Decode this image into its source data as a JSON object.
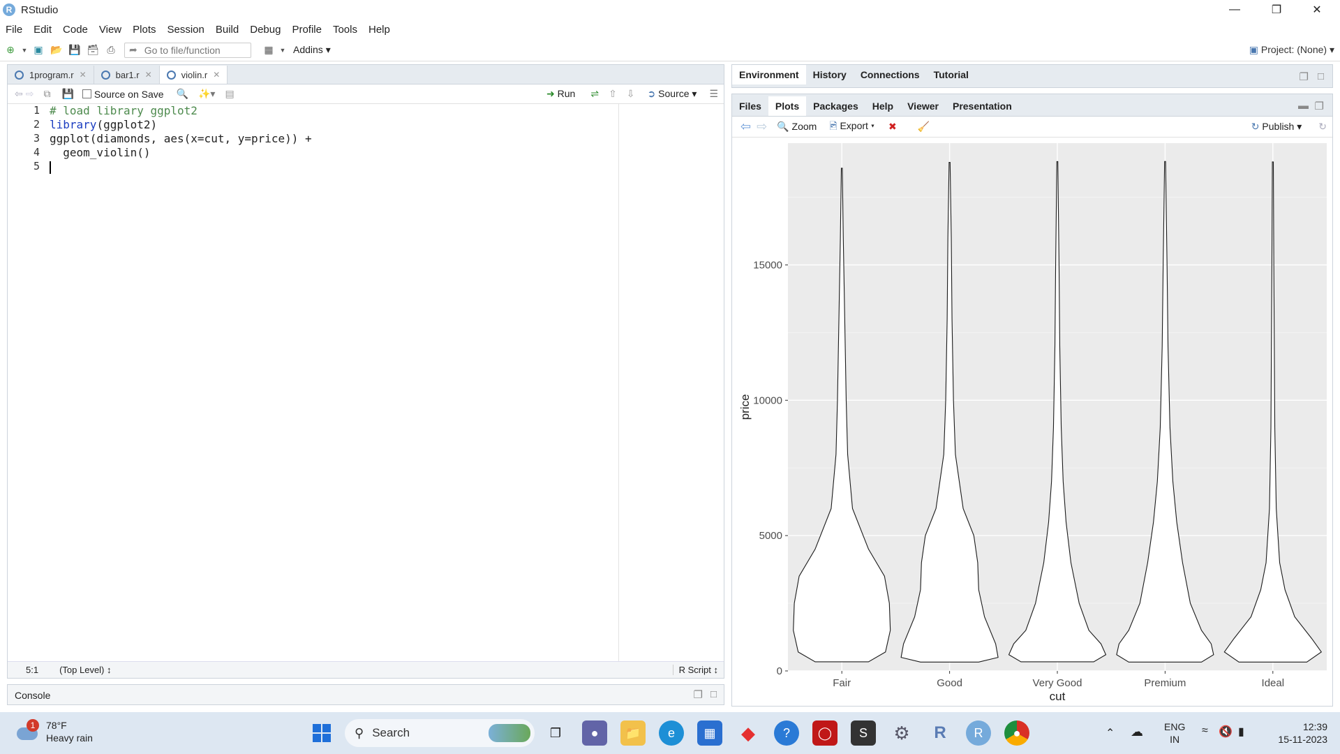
{
  "app": {
    "title": "RStudio",
    "logo_letter": "R"
  },
  "menu": [
    "File",
    "Edit",
    "Code",
    "View",
    "Plots",
    "Session",
    "Build",
    "Debug",
    "Profile",
    "Tools",
    "Help"
  ],
  "toolbar": {
    "goto_placeholder": "Go to file/function",
    "addins": "Addins",
    "project": "Project: (None)"
  },
  "editor": {
    "tabs": [
      {
        "label": "1program.r"
      },
      {
        "label": "bar1.r"
      },
      {
        "label": "violin.r"
      }
    ],
    "source_on_save": "Source on Save",
    "run_label": "Run",
    "source_label": "Source",
    "line_numbers": [
      "1",
      "2",
      "3",
      "4",
      "5"
    ],
    "lines": [
      {
        "parts": [
          {
            "t": "# load library ggplot2",
            "c": "cmt"
          }
        ]
      },
      {
        "parts": [
          {
            "t": "library",
            "c": "fn"
          },
          {
            "t": "(ggplot2)",
            "c": ""
          }
        ]
      },
      {
        "parts": [
          {
            "t": "ggplot(diamonds, aes(x=cut, y=price)) +",
            "c": ""
          }
        ]
      },
      {
        "parts": [
          {
            "t": "  geom_violin()",
            "c": ""
          }
        ]
      },
      {
        "parts": [
          {
            "t": "",
            "c": ""
          }
        ]
      }
    ],
    "status_position": "5:1",
    "status_scope": "(Top Level)",
    "status_type": "R Script"
  },
  "console": {
    "label": "Console"
  },
  "env_pane": {
    "tabs": [
      "Environment",
      "History",
      "Connections",
      "Tutorial"
    ]
  },
  "files_pane": {
    "tabs": [
      "Files",
      "Plots",
      "Packages",
      "Help",
      "Viewer",
      "Presentation"
    ],
    "active_tab": "Plots",
    "zoom": "Zoom",
    "export": "Export",
    "publish": "Publish"
  },
  "chart_data": {
    "type": "violin",
    "categories": [
      "Fair",
      "Good",
      "Very Good",
      "Premium",
      "Ideal"
    ],
    "xlabel": "cut",
    "ylabel": "price",
    "ylim": [
      0,
      19500
    ],
    "yticks": [
      0,
      5000,
      10000,
      15000
    ],
    "ytick_labels": [
      "0",
      "5000",
      "10000",
      "15000"
    ],
    "grid": true,
    "violins": [
      {
        "name": "Fair",
        "min": 337,
        "max": 18574,
        "profile": [
          [
            337,
            0.55
          ],
          [
            700,
            0.9
          ],
          [
            1500,
            1.0
          ],
          [
            2500,
            0.98
          ],
          [
            3500,
            0.88
          ],
          [
            4500,
            0.55
          ],
          [
            6000,
            0.22
          ],
          [
            8000,
            0.12
          ],
          [
            10000,
            0.09
          ],
          [
            12000,
            0.07
          ],
          [
            14000,
            0.05
          ],
          [
            16000,
            0.03
          ],
          [
            18574,
            0.01
          ]
        ]
      },
      {
        "name": "Good",
        "min": 327,
        "max": 18788,
        "profile": [
          [
            327,
            0.6
          ],
          [
            500,
            1.0
          ],
          [
            1000,
            0.95
          ],
          [
            2000,
            0.72
          ],
          [
            3000,
            0.6
          ],
          [
            4000,
            0.58
          ],
          [
            5000,
            0.5
          ],
          [
            6000,
            0.28
          ],
          [
            8000,
            0.12
          ],
          [
            10000,
            0.08
          ],
          [
            13000,
            0.05
          ],
          [
            16000,
            0.035
          ],
          [
            18788,
            0.01
          ]
        ]
      },
      {
        "name": "Very Good",
        "min": 336,
        "max": 18818,
        "profile": [
          [
            336,
            0.75
          ],
          [
            600,
            1.0
          ],
          [
            1000,
            0.9
          ],
          [
            1500,
            0.65
          ],
          [
            2500,
            0.45
          ],
          [
            4000,
            0.28
          ],
          [
            5500,
            0.18
          ],
          [
            7000,
            0.12
          ],
          [
            9000,
            0.08
          ],
          [
            12000,
            0.05
          ],
          [
            15000,
            0.035
          ],
          [
            18818,
            0.01
          ]
        ]
      },
      {
        "name": "Premium",
        "min": 326,
        "max": 18823,
        "profile": [
          [
            326,
            0.75
          ],
          [
            600,
            1.0
          ],
          [
            1000,
            0.95
          ],
          [
            1500,
            0.75
          ],
          [
            2500,
            0.52
          ],
          [
            4000,
            0.36
          ],
          [
            5500,
            0.24
          ],
          [
            7000,
            0.16
          ],
          [
            9000,
            0.1
          ],
          [
            12000,
            0.06
          ],
          [
            15000,
            0.04
          ],
          [
            18823,
            0.01
          ]
        ]
      },
      {
        "name": "Ideal",
        "min": 326,
        "max": 18806,
        "profile": [
          [
            326,
            0.7
          ],
          [
            700,
            1.0
          ],
          [
            1200,
            0.8
          ],
          [
            2000,
            0.45
          ],
          [
            3000,
            0.25
          ],
          [
            4000,
            0.14
          ],
          [
            6000,
            0.07
          ],
          [
            9000,
            0.04
          ],
          [
            12000,
            0.03
          ],
          [
            15000,
            0.02
          ],
          [
            18806,
            0.01
          ]
        ]
      }
    ]
  },
  "taskbar": {
    "weather_temp": "78°F",
    "weather_desc": "Heavy rain",
    "weather_badge": "1",
    "search": "Search",
    "lang1": "ENG",
    "lang2": "IN",
    "time": "12:39",
    "date": "15-11-2023"
  }
}
